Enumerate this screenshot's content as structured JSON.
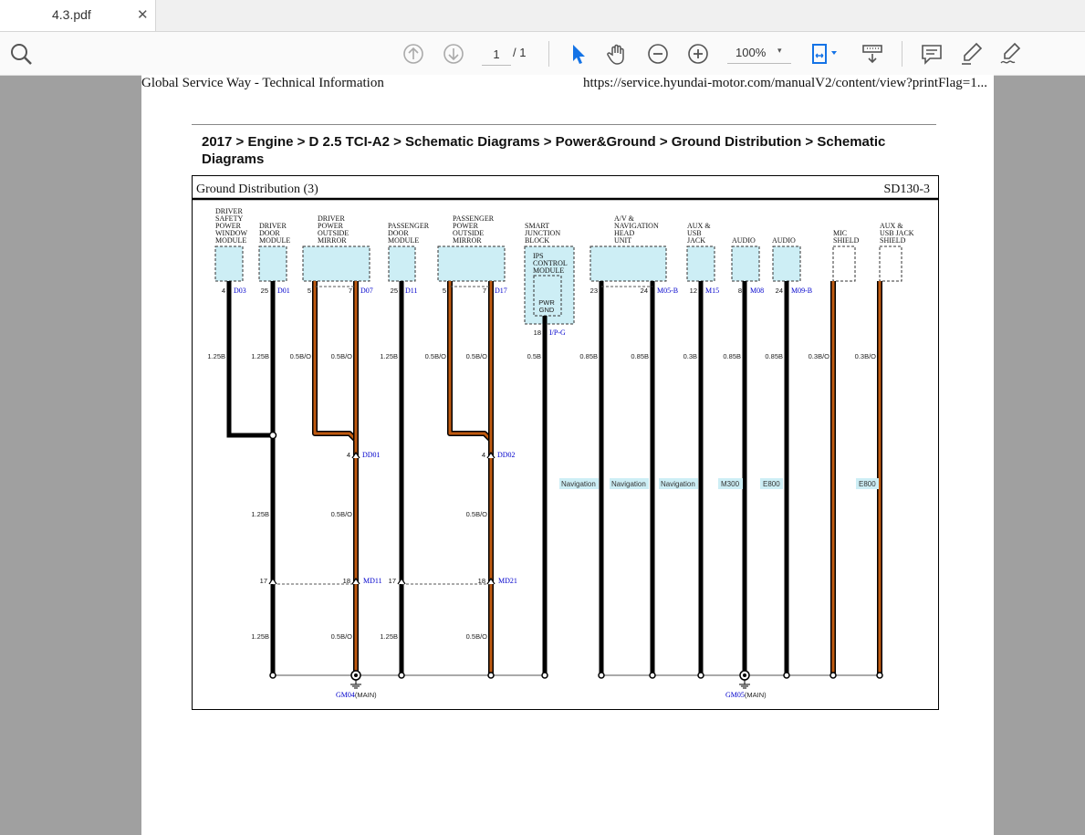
{
  "tab": {
    "title": "4.3.pdf",
    "close": "✕"
  },
  "toolbar": {
    "page_current": "1",
    "page_total": "/ 1",
    "zoom": "100%",
    "zoom_caret": "▾"
  },
  "doc": {
    "header_left": "Global Service Way - Technical Information",
    "header_right": "https://service.hyundai-motor.com/manualV2/content/view?printFlag=1...",
    "breadcrumb": "2017 > Engine > D 2.5 TCI-A2 > Schematic Diagrams > Power&Ground > Ground Distribution > Schematic Diagrams"
  },
  "diagram": {
    "title": "Ground Distribution (3)",
    "code": "SD130-3",
    "modules": {
      "m1": [
        "DRIVER",
        "SAFETY",
        "POWER",
        "WINDOW",
        "MODULE"
      ],
      "m2": [
        "DRIVER",
        "DOOR",
        "MODULE"
      ],
      "m3": [
        "DRIVER",
        "POWER",
        "OUTSIDE",
        "MIRROR"
      ],
      "m4": [
        "PASSENGER",
        "DOOR",
        "MODULE"
      ],
      "m5": [
        "PASSENGER",
        "POWER",
        "OUTSIDE",
        "MIRROR"
      ],
      "m6": [
        "SMART",
        "JUNCTION",
        "BLOCK"
      ],
      "m6_inner": [
        "IPS",
        "CONTROL",
        "MODULE"
      ],
      "m6_pwr": [
        "PWR",
        "GND"
      ],
      "m7": [
        "A/V &",
        "NAVIGATION",
        "HEAD",
        "UNIT"
      ],
      "m8": [
        "AUX &",
        "USB",
        "JACK"
      ],
      "m9": [
        "AUDIO"
      ],
      "m10": [
        "AUDIO"
      ],
      "m11": [
        "MIC",
        "SHIELD"
      ],
      "m12": [
        "AUX &",
        "USB JACK",
        "SHIELD"
      ]
    },
    "pins": {
      "p1": "4",
      "c1": "D03",
      "p2": "25",
      "c2": "D01",
      "p3a": "5",
      "p3b": "7",
      "c3": "D07",
      "p4": "25",
      "c4": "D11",
      "p5a": "5",
      "p5b": "7",
      "c5": "D17",
      "p6": "18",
      "c6": "I/P-G",
      "p7a": "23",
      "p7b": "24",
      "c7": "M05-B",
      "p8": "12",
      "c8": "M15",
      "p9": "8",
      "c9": "M08",
      "p10": "24",
      "c10": "M09-B"
    },
    "wires_top": {
      "w1": "1.25B",
      "w2": "1.25B",
      "w3a": "0.5B/O",
      "w3b": "0.5B/O",
      "w4": "1.25B",
      "w5a": "0.5B/O",
      "w5b": "0.5B/O",
      "w6": "0.5B",
      "w7a": "0.85B",
      "w7b": "0.85B",
      "w8": "0.3B",
      "w9": "0.85B",
      "w10": "0.85B",
      "w11": "0.3B/O",
      "w12": "0.3B/O"
    },
    "wires_mid": {
      "w2": "1.25B",
      "w3": "0.5B/O",
      "w5": "0.5B/O"
    },
    "wires_bot": {
      "w2": "1.25B",
      "w3": "0.5B/O",
      "w4": "1.25B",
      "w5": "0.5B/O"
    },
    "dd": {
      "dd1_pin": "4",
      "dd1": "DD01",
      "dd2_pin": "4",
      "dd2": "DD02"
    },
    "md": {
      "md1_pin_a": "17",
      "md1_pin_b": "18",
      "md1": "MD11",
      "md2_pin_a": "17",
      "md2_pin_b": "18",
      "md2": "MD21"
    },
    "option_tags": [
      "Navigation",
      "Navigation",
      "Navigation",
      "M300",
      "E800",
      "E800"
    ],
    "grounds": {
      "g1": "GM04",
      "g1_loc": "(MAIN)",
      "g2": "GM05",
      "g2_loc": "(MAIN)"
    }
  },
  "colors": {
    "wire_black": "#000000",
    "wire_orange": "#c05a10",
    "module_fill": "#cdeef5",
    "connector_blue": "#0000cc"
  }
}
